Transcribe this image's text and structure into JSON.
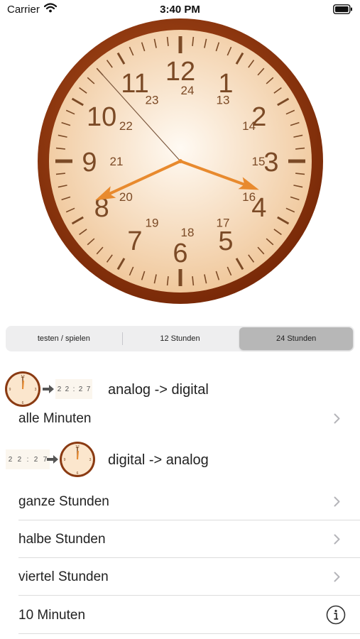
{
  "status_bar": {
    "carrier": "Carrier",
    "time": "3:40 PM"
  },
  "clock": {
    "hours_12": [
      "12",
      "1",
      "2",
      "3",
      "4",
      "5",
      "6",
      "7",
      "8",
      "9",
      "10",
      "11"
    ],
    "hours_24": [
      "24",
      "13",
      "14",
      "15",
      "16",
      "17",
      "18",
      "19",
      "20",
      "21",
      "22",
      "23"
    ],
    "time_shown": {
      "hour": 15,
      "minute": 40,
      "second": 53
    },
    "colors": {
      "rim_outer": "#7a2a08",
      "rim_inner": "#b4521e",
      "face_center": "#fffaf3",
      "face_edge": "#f0c89c",
      "numerals": "#7b4a26",
      "hands": "#e88a2e",
      "second_hand": "#7d5a40"
    }
  },
  "segmented_control": {
    "options": [
      "testen / spielen",
      "12 Stunden",
      "24 Stunden"
    ],
    "selected_index": 2
  },
  "sections": {
    "analog_to_digital": {
      "title": "analog -> digital",
      "thumb_digits": [
        "2",
        "2",
        ":",
        "2",
        "7"
      ]
    },
    "digital_to_analog": {
      "title": "digital -> analog",
      "thumb_digits": [
        "2",
        "2",
        ":",
        "2",
        "7"
      ]
    }
  },
  "rows": {
    "alle_minuten": "alle Minuten",
    "ganze_stunden": "ganze Stunden",
    "halbe_stunden": "halbe Stunden",
    "viertel_stunden": "viertel Stunden",
    "zehn_minuten": "10 Minuten"
  },
  "icons": {
    "chevron": "chevron-right-icon",
    "info": "info-circle-icon",
    "wifi": "wifi-icon",
    "battery": "battery-icon",
    "arrow": "arrow-right-icon"
  }
}
